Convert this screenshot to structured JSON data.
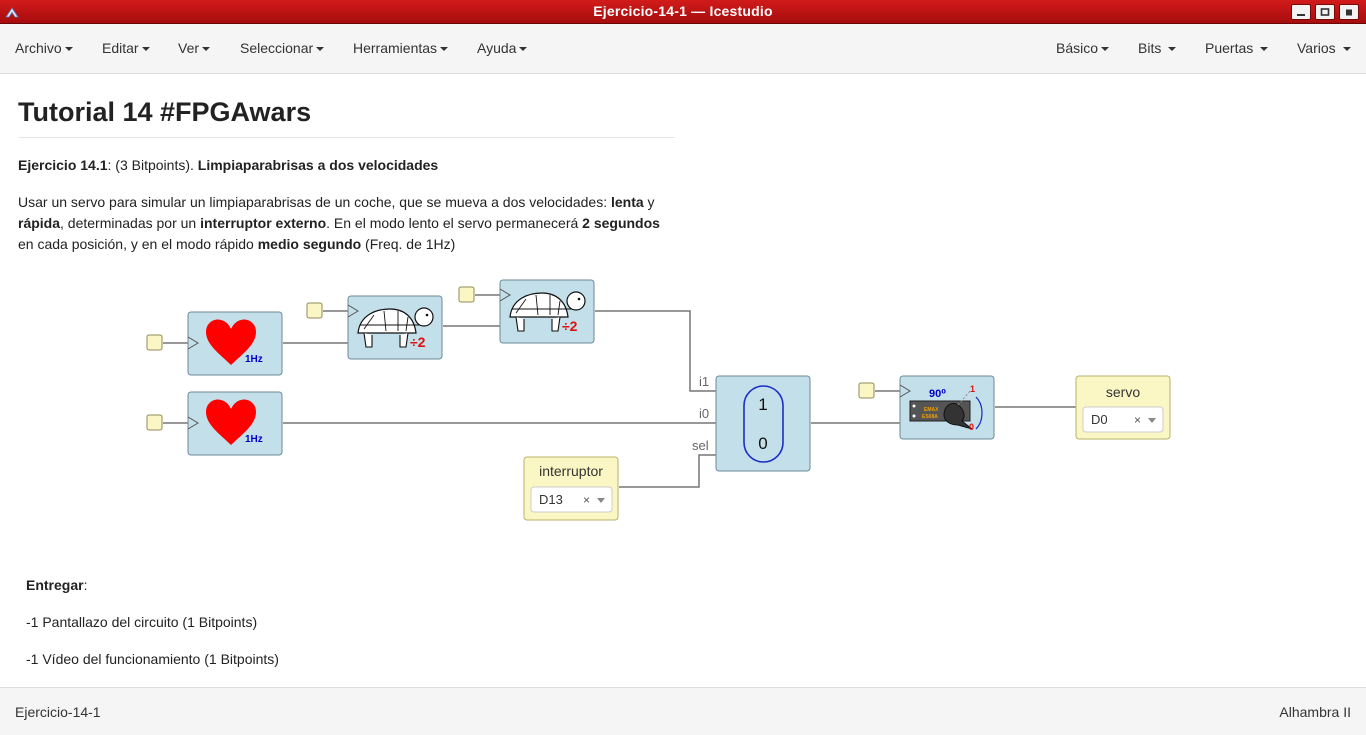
{
  "window": {
    "title": "Ejercicio-14-1 — Icestudio"
  },
  "menu": {
    "left": [
      "Archivo",
      "Editar",
      "Ver",
      "Seleccionar",
      "Herramientas",
      "Ayuda"
    ],
    "right": [
      "Básico",
      "Bits",
      "Puertas",
      "Varios"
    ]
  },
  "doc": {
    "title": "Tutorial 14 #FPGAwars",
    "p1": {
      "bold1": "Ejercicio 14.1",
      "text1": ": (3 Bitpoints). ",
      "bold2": "Limpiaparabrisas a dos velocidades"
    },
    "p2": {
      "t1": "Usar un servo para simular un limpiaparabrisas de un coche, que se mueva a dos velocidades: ",
      "b1": "lenta",
      "t2": " y ",
      "b2": "rápida",
      "t3": ", determinadas por un ",
      "b3": "interruptor externo",
      "t4": ". En el modo lento el servo permanecerá ",
      "b4": "2 segundos",
      "t5": " en cada posición, y en el modo rápido ",
      "b5": "medio segundo",
      "t6": " (Freq. de 1Hz)"
    },
    "deliver_label": "Entregar",
    "deliver_colon": ":",
    "item1": "-1 Pantallazo del circuito (1 Bitpoints)",
    "item2": "-1 Vídeo del funcionamiento (1 Bitpoints)"
  },
  "circuit": {
    "heart_label": "1Hz",
    "divider_label": "÷2",
    "mux_top": "1",
    "mux_bottom": "0",
    "port_i1": "i1",
    "port_i0": "i0",
    "port_sel": "sel",
    "servo_angle": "90⁰",
    "servo_brand": "EMAX",
    "servo_model": "ES08A",
    "servo_one": "1",
    "servo_zero": "0",
    "interruptor": {
      "label": "interruptor",
      "pin": "D13",
      "clear": "×"
    },
    "servo": {
      "label": "servo",
      "pin": "D0",
      "clear": "×"
    }
  },
  "status": {
    "left": "Ejercicio-14-1",
    "right": "Alhambra II"
  },
  "colors": {
    "titlebar": "#b81313",
    "block": "#c3dfe9",
    "io_block": "#fbf7c4",
    "heart": "#ff0000",
    "mux_ring": "#1a2fc7"
  }
}
